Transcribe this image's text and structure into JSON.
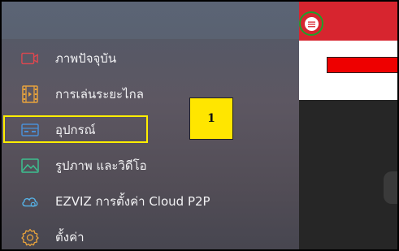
{
  "menu": {
    "items": [
      {
        "label": "ภาพปัจจุบัน",
        "icon": "live-view-icon"
      },
      {
        "label": "การเล่นระยะไกล",
        "icon": "remote-playback-icon"
      },
      {
        "label": "อุปกรณ์",
        "icon": "device-icon"
      },
      {
        "label": "รูปภาพ และวิดีโอ",
        "icon": "pictures-videos-icon"
      },
      {
        "label": "EZVIZ การตั้งค่า Cloud P2P",
        "icon": "cloud-icon"
      },
      {
        "label": "ตั้งค่า",
        "icon": "settings-icon"
      }
    ]
  },
  "annotation": {
    "callout_number": "1"
  },
  "colors": {
    "header_red": "#d7252f",
    "highlight_yellow": "#ffef00",
    "ring_green": "#1fa02a",
    "accent_orange": "#e8a33c"
  }
}
